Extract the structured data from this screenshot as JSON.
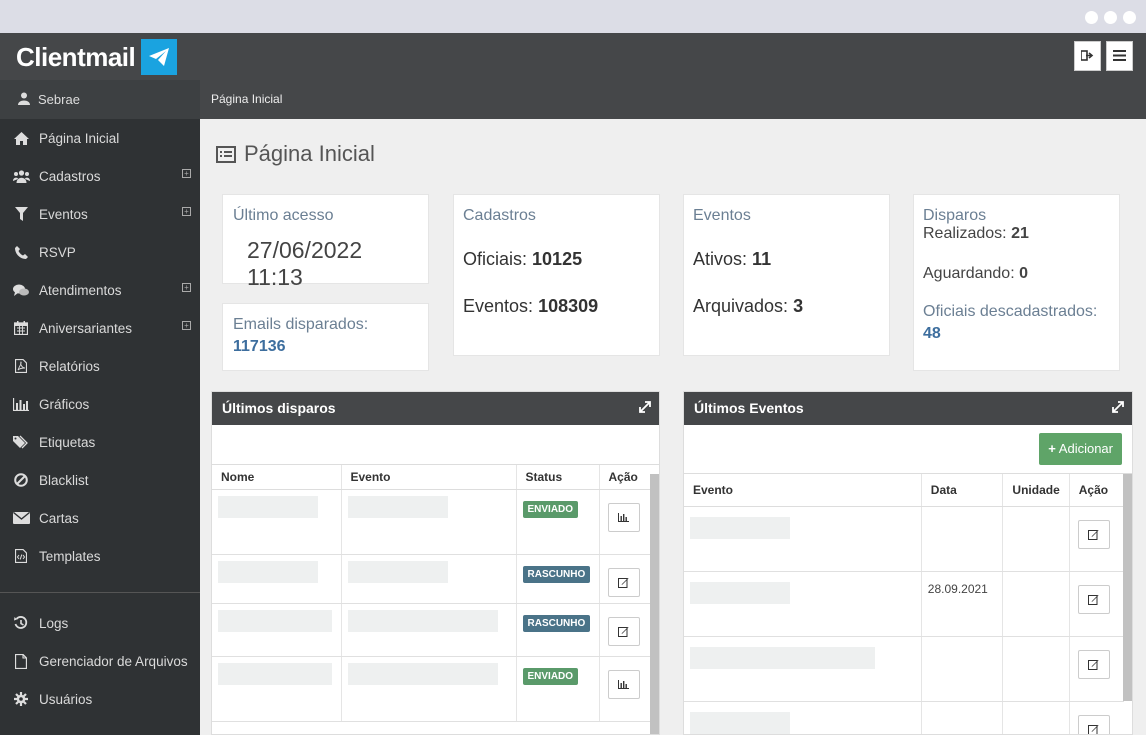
{
  "app": {
    "brand": "Clientmail",
    "user": "Sebrae",
    "breadcrumb": "Página Inicial"
  },
  "sidebar": {
    "items": [
      {
        "label": "Página Inicial",
        "icon": "home-icon",
        "expandable": false
      },
      {
        "label": "Cadastros",
        "icon": "users-icon",
        "expandable": true
      },
      {
        "label": "Eventos",
        "icon": "filter-icon",
        "expandable": true
      },
      {
        "label": "RSVP",
        "icon": "phone-icon",
        "expandable": false
      },
      {
        "label": "Atendimentos",
        "icon": "chat-icon",
        "expandable": true
      },
      {
        "label": "Aniversariantes",
        "icon": "calendar-icon",
        "expandable": true
      },
      {
        "label": "Relatórios",
        "icon": "pdf-icon",
        "expandable": false
      },
      {
        "label": "Gráficos",
        "icon": "bar-chart-icon",
        "expandable": false
      },
      {
        "label": "Etiquetas",
        "icon": "tag-icon",
        "expandable": false
      },
      {
        "label": "Blacklist",
        "icon": "ban-icon",
        "expandable": false
      },
      {
        "label": "Cartas",
        "icon": "envelope-icon",
        "expandable": false
      },
      {
        "label": "Templates",
        "icon": "code-file-icon",
        "expandable": false
      }
    ],
    "bottom_items": [
      {
        "label": "Logs",
        "icon": "history-icon"
      },
      {
        "label": "Gerenciador de Arquivos",
        "icon": "file-icon"
      },
      {
        "label": "Usuários",
        "icon": "cog-icon"
      }
    ]
  },
  "page": {
    "title": "Página Inicial"
  },
  "stats": {
    "ultimo_acesso": {
      "label": "Último acesso",
      "value": "27/06/2022 11:13"
    },
    "emails": {
      "label": "Emails disparados:",
      "value": "117136"
    },
    "cadastros": {
      "label": "Cadastros",
      "oficiais_label": "Oficiais:",
      "oficiais_value": "10125",
      "eventos_label": "Eventos:",
      "eventos_value": "108309"
    },
    "eventos": {
      "label": "Eventos",
      "ativos_label": "Ativos:",
      "ativos_value": "11",
      "arquivados_label": "Arquivados:",
      "arquivados_value": "3"
    },
    "disparos": {
      "label": "Disparos",
      "realizados_label": "Realizados:",
      "realizados_value": "21",
      "aguardando_label": "Aguardando:",
      "aguardando_value": "0",
      "descad_label": "Oficiais descadastrados:",
      "descad_value": "48"
    }
  },
  "ultimos_disparos": {
    "title": "Últimos disparos",
    "columns": [
      "Nome",
      "Evento",
      "Status",
      "Ação"
    ],
    "rows": [
      {
        "status": "ENVIADO",
        "status_type": "enviado",
        "action": "chart"
      },
      {
        "status": "RASCUNHO",
        "status_type": "rascunho",
        "action": "edit"
      },
      {
        "status": "RASCUNHO",
        "status_type": "rascunho",
        "action": "edit"
      },
      {
        "status": "ENVIADO",
        "status_type": "enviado",
        "action": "chart"
      }
    ]
  },
  "ultimos_eventos": {
    "title": "Últimos Eventos",
    "add_label": "Adicionar",
    "columns": [
      "Evento",
      "Data",
      "Unidade",
      "Ação"
    ],
    "rows": [
      {
        "data": ""
      },
      {
        "data": "28.09.2021"
      },
      {
        "data": ""
      },
      {
        "data": ""
      }
    ]
  },
  "colors": {
    "sidebar": "#2f3234",
    "topbar": "#454749",
    "accent_blue": "#1aa3e0",
    "badge_enviado": "#5a9a6a",
    "badge_rascunho": "#4a7388",
    "add_button": "#5fa468"
  }
}
